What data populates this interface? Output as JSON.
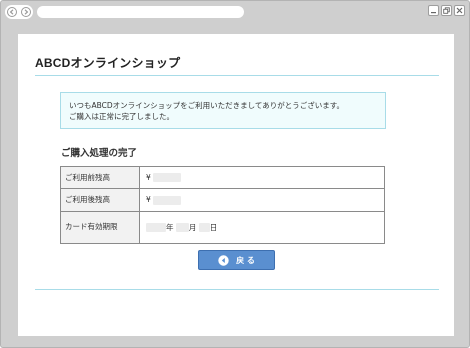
{
  "browser": {
    "nav_icons": [
      "back-icon",
      "forward-icon"
    ],
    "window_controls": [
      "minimize-icon",
      "restore-icon",
      "close-icon"
    ]
  },
  "shop": {
    "title": "ABCDオンラインショップ"
  },
  "notice": {
    "line1": "いつもABCDオンラインショップをご利用いただきましてありがとうございます。",
    "line2": "ご購入は正常に完了しました。"
  },
  "section": {
    "title": "ご購入処理の完了"
  },
  "details": {
    "balance_before_label": "ご利用前残高",
    "balance_before_currency": "¥",
    "balance_after_label": "ご利用後残高",
    "balance_after_currency": "¥",
    "expiry_label": "カード有効期限",
    "expiry_year_unit": "年",
    "expiry_month_unit": "月",
    "expiry_day_unit": "日"
  },
  "actions": {
    "back_label": "戻 る"
  },
  "colors": {
    "accent": "#5a8fd0",
    "rule": "#a8dce8",
    "notice_bg": "#f0fcfd"
  }
}
